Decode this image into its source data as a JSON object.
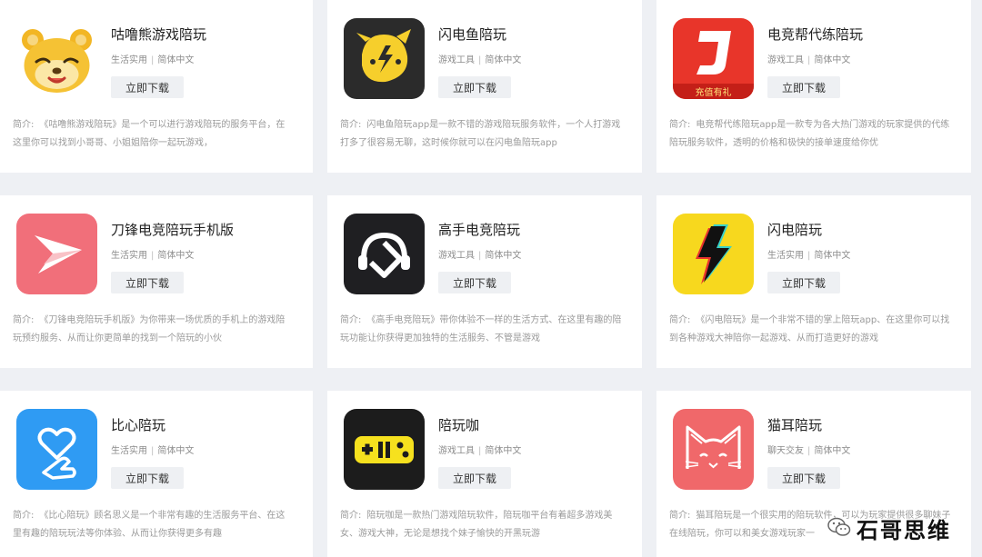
{
  "cards": [
    {
      "name": "咕噜熊游戏陪玩",
      "category": "生活实用",
      "lang": "简体中文",
      "button": "立即下载",
      "intro_label": "简介:",
      "intro": "《咕噜熊游戏陪玩》是一个可以进行游戏陪玩的服务平台，在这里你可以找到小哥哥、小姐姐陪你一起玩游戏，",
      "icon": "bear-icon"
    },
    {
      "name": "闪电鱼陪玩",
      "category": "游戏工具",
      "lang": "简体中文",
      "button": "立即下载",
      "intro_label": "简介:",
      "intro": "闪电鱼陪玩app是一款不错的游戏陪玩服务软件，一个人打游戏打多了很容易无聊，这时候你就可以在闪电鱼陪玩app",
      "icon": "lightning-fish-icon"
    },
    {
      "name": "电竞帮代练陪玩",
      "category": "游戏工具",
      "lang": "简体中文",
      "button": "立即下载",
      "intro_label": "简介:",
      "intro": "电竞帮代练陪玩app是一款专为各大热门游戏的玩家提供的代练陪玩服务软件，透明的价格和极快的接单速度给你优",
      "icon": "esports-help-icon",
      "badge": "充值有礼"
    },
    {
      "name": "刀锋电竞陪玩手机版",
      "category": "生活实用",
      "lang": "简体中文",
      "button": "立即下载",
      "intro_label": "简介:",
      "intro": "《刀锋电竞陪玩手机版》为你带来一场优质的手机上的游戏陪玩预约服务、从而让你更简单的找到一个陪玩的小伙",
      "icon": "blade-icon"
    },
    {
      "name": "高手电竞陪玩",
      "category": "游戏工具",
      "lang": "简体中文",
      "button": "立即下载",
      "intro_label": "简介:",
      "intro": "《高手电竞陪玩》带你体验不一样的生活方式、在这里有趣的陪玩功能让你获得更加独特的生活服务、不管是游戏",
      "icon": "headphones-icon"
    },
    {
      "name": "闪电陪玩",
      "category": "生活实用",
      "lang": "简体中文",
      "button": "立即下载",
      "intro_label": "简介:",
      "intro": "《闪电陪玩》是一个非常不错的掌上陪玩app、在这里你可以找到各种游戏大神陪你一起游戏、从而打造更好的游戏",
      "icon": "lightning-icon"
    },
    {
      "name": "比心陪玩",
      "category": "生活实用",
      "lang": "简体中文",
      "button": "立即下载",
      "intro_label": "简介:",
      "intro": "《比心陪玩》顾名思义是一个非常有趣的生活服务平台、在这里有趣的陪玩玩法等你体验、从而让你获得更多有趣",
      "icon": "heart-hand-icon"
    },
    {
      "name": "陪玩咖",
      "category": "游戏工具",
      "lang": "简体中文",
      "button": "立即下载",
      "intro_label": "简介:",
      "intro": "陪玩咖是一款热门游戏陪玩软件，陪玩咖平台有着超多游戏美女、游戏大神，无论是想找个妹子愉快的开黑玩游",
      "icon": "gamepad-icon"
    },
    {
      "name": "猫耳陪玩",
      "category": "聊天交友",
      "lang": "简体中文",
      "button": "立即下载",
      "intro_label": "简介:",
      "intro": "猫耳陪玩是一个很实用的陪玩软件，可以为玩家提供很多聊妹子在线陪玩，你可以和美女游戏玩家一",
      "icon": "cat-icon"
    }
  ],
  "watermark": {
    "text": "石哥思维",
    "icon": "wechat-icon"
  }
}
